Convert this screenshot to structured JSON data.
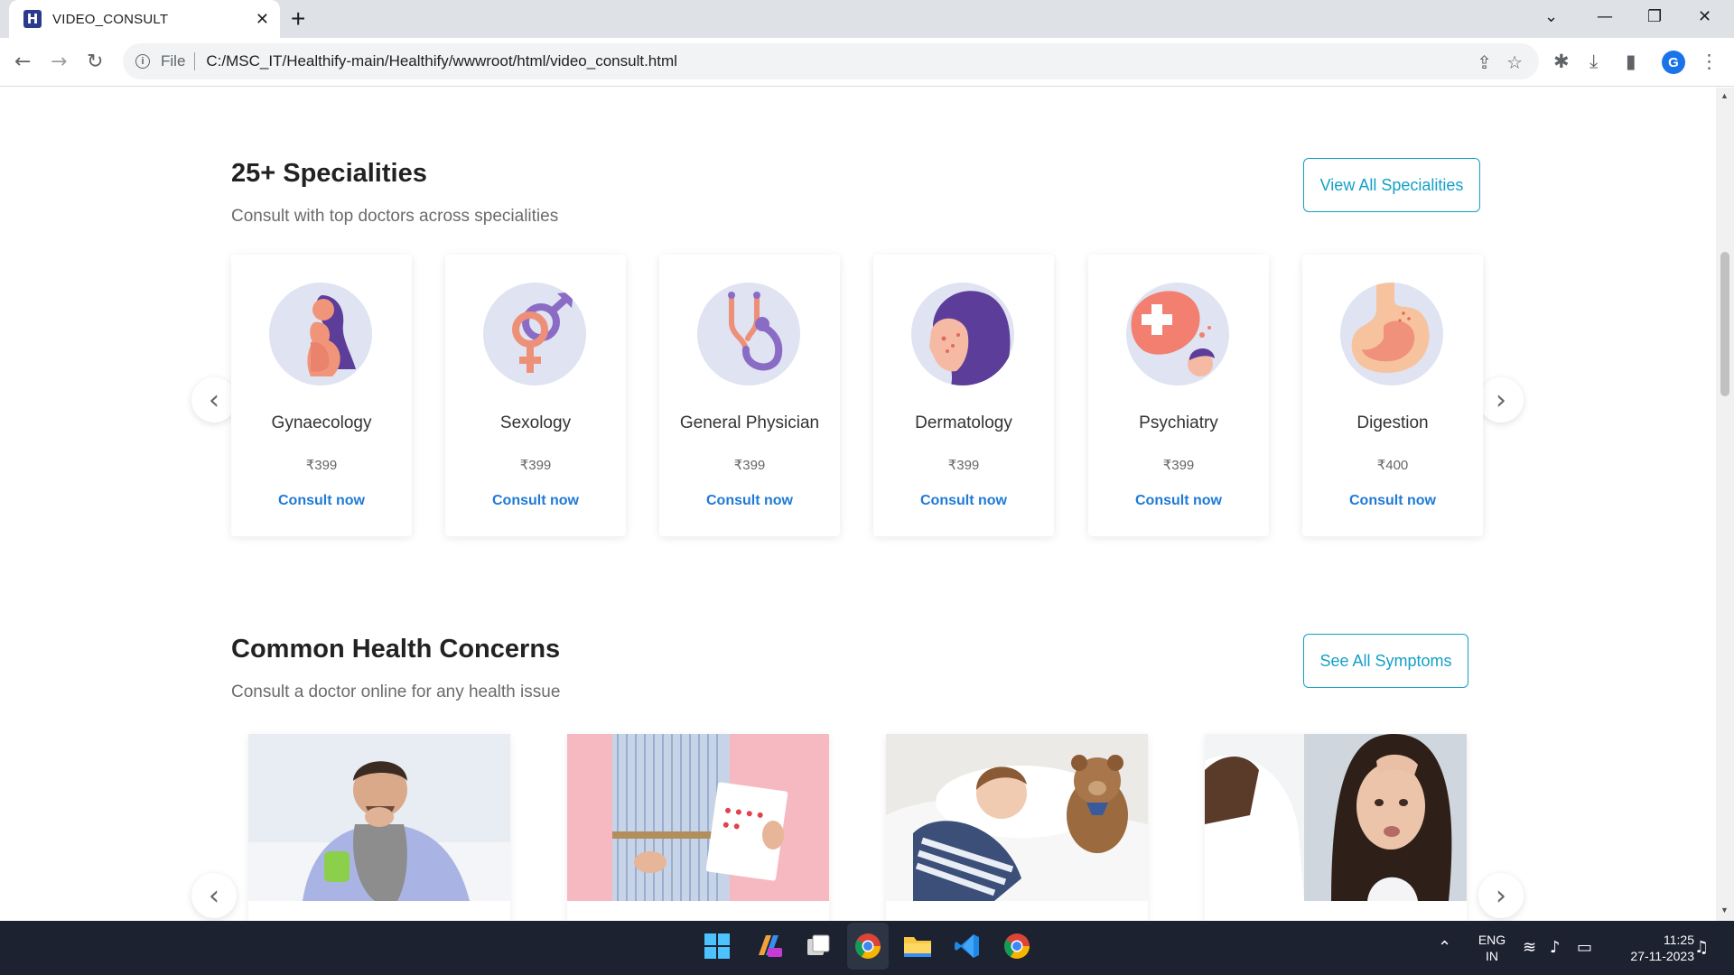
{
  "browser": {
    "tab_title": "VIDEO_CONSULT",
    "favicon_letter": "H",
    "url_scheme": "File",
    "url": "C:/MSC_IT/Healthify-main/Healthify/wwwroot/html/video_consult.html",
    "profile_initial": "G"
  },
  "specialities": {
    "title": "25+ Specialities",
    "subtitle": "Consult with top doctors across specialities",
    "view_all_label": "View All Specialities",
    "items": [
      {
        "name": "Gynaecology",
        "price": "₹399",
        "cta": "Consult now"
      },
      {
        "name": "Sexology",
        "price": "₹399",
        "cta": "Consult now"
      },
      {
        "name": "General Physician",
        "price": "₹399",
        "cta": "Consult now"
      },
      {
        "name": "Dermatology",
        "price": "₹399",
        "cta": "Consult now"
      },
      {
        "name": "Psychiatry",
        "price": "₹399",
        "cta": "Consult now"
      },
      {
        "name": "Digestion",
        "price": "₹400",
        "cta": "Consult now"
      }
    ]
  },
  "concerns": {
    "title": "Common Health Concerns",
    "subtitle": "Consult a doctor online for any health issue",
    "see_all_label": "See All Symptoms"
  },
  "taskbar": {
    "language": "ENG",
    "region": "IN",
    "time": "11:25",
    "date": "27-11-2023"
  },
  "colors": {
    "accent": "#14a0c8",
    "link": "#1f7ad6",
    "icon_bg": "#dfe3f2"
  }
}
